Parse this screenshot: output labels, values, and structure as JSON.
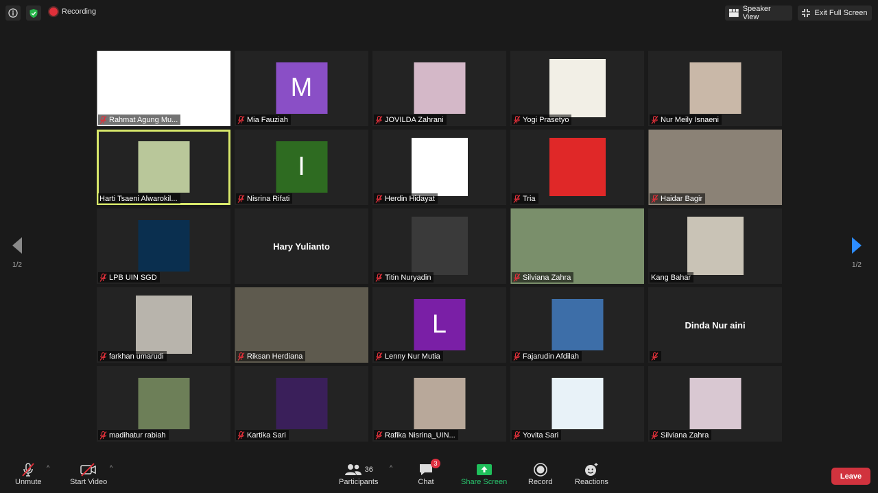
{
  "top_bar": {
    "recording_label": "Recording",
    "speaker_view_label": "Speaker View",
    "exit_fullscreen_label": "Exit Full Screen"
  },
  "tiles": [
    {
      "name": "Rahmat Agung Mu...",
      "kind": "image",
      "bg": "#ffffff",
      "muted": true
    },
    {
      "name": "Mia Fauziah",
      "kind": "letter",
      "letter": "M",
      "bg": "#8a4fc6",
      "muted": true
    },
    {
      "name": "JOVILDA Zahrani",
      "kind": "image",
      "bg": "#d4b8c8",
      "muted": true
    },
    {
      "name": "Yogi Prasetyo",
      "kind": "image",
      "bg": "#f2efe6",
      "muted": true
    },
    {
      "name": "Nur Meily Isnaeni",
      "kind": "image",
      "bg": "#c9b8a8",
      "muted": true
    },
    {
      "name": "Harti Tsaeni Alwarokil...",
      "kind": "image",
      "bg": "#b9c79a",
      "muted": false,
      "active": true
    },
    {
      "name": "Nisrina Rifati",
      "kind": "letter",
      "letter": "I",
      "bg": "#2e6b21",
      "muted": true
    },
    {
      "name": "Herdin Hidayat",
      "kind": "image",
      "bg": "#ffffff",
      "muted": true
    },
    {
      "name": "Tria",
      "kind": "image",
      "bg": "#e02828",
      "muted": true
    },
    {
      "name": "Haidar Bagir",
      "kind": "image",
      "bg": "#8b8276",
      "muted": true
    },
    {
      "name": "LPB UIN SGD",
      "kind": "image",
      "bg": "#0a2f4f",
      "muted": true
    },
    {
      "name": "Hary Yulianto",
      "kind": "name_only",
      "muted": false,
      "show_tag": false
    },
    {
      "name": "Titin Nuryadin",
      "kind": "image",
      "bg": "#3a3a3a",
      "muted": true
    },
    {
      "name": "Silviana Zahra",
      "kind": "image",
      "bg": "#7a8f6b",
      "muted": true
    },
    {
      "name": "Kang Bahar",
      "kind": "image",
      "bg": "#c9c3b6",
      "muted": false
    },
    {
      "name": "farkhan umarudi",
      "kind": "image",
      "bg": "#b8b4ac",
      "muted": true
    },
    {
      "name": "Riksan Herdiana",
      "kind": "image",
      "bg": "#5e5a4e",
      "muted": true
    },
    {
      "name": "Lenny Nur Mutia",
      "kind": "letter",
      "letter": "L",
      "bg": "#7a1fa6",
      "muted": true
    },
    {
      "name": "Fajarudin Afdilah",
      "kind": "image",
      "bg": "#3d6ea8",
      "muted": true
    },
    {
      "name": "Dinda Nur aini",
      "kind": "name_only",
      "muted": true,
      "show_tag": true
    },
    {
      "name": "madihatur rabiah",
      "kind": "image",
      "bg": "#6d7f58",
      "muted": true
    },
    {
      "name": "Kartika Sari",
      "kind": "image",
      "bg": "#3a1f5a",
      "muted": true
    },
    {
      "name": "Rafika Nisrina_UIN...",
      "kind": "image",
      "bg": "#b8a89a",
      "muted": true
    },
    {
      "name": "Yovita Sari",
      "kind": "image",
      "bg": "#e8f2f8",
      "muted": true
    },
    {
      "name": "Silviana Zahra",
      "kind": "image",
      "bg": "#d9c8d2",
      "muted": true
    }
  ],
  "pager": {
    "left_label": "1/2",
    "right_label": "1/2"
  },
  "bottom_bar": {
    "unmute_label": "Unmute",
    "start_video_label": "Start Video",
    "participants_label": "Participants",
    "participants_count": "36",
    "chat_label": "Chat",
    "chat_badge": "3",
    "share_screen_label": "Share Screen",
    "record_label": "Record",
    "reactions_label": "Reactions",
    "leave_label": "Leave"
  }
}
